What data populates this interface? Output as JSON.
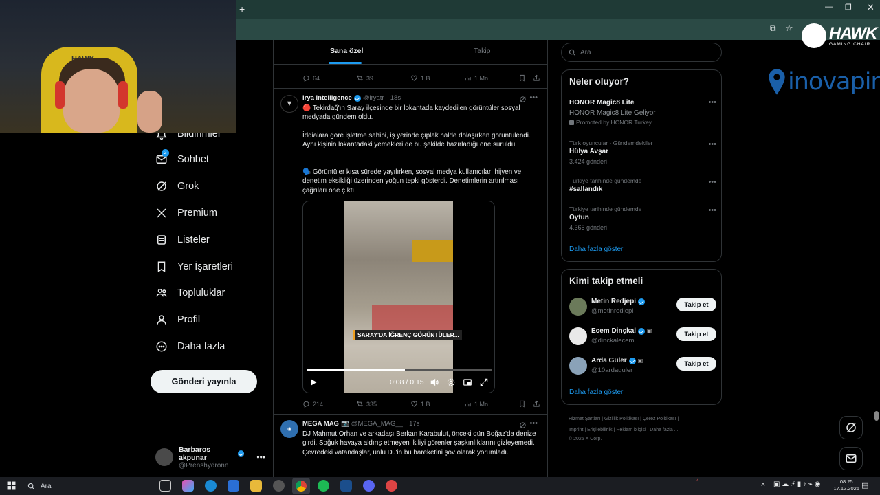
{
  "browser": {
    "new_tab_icon": "plus-icon",
    "window_controls": [
      "minimize-icon",
      "restore-icon",
      "close-icon"
    ]
  },
  "webcam": {
    "chair_brand": "HAWK"
  },
  "nav": {
    "items": [
      {
        "label": "Bildirimler",
        "icon": "bell-icon"
      },
      {
        "label": "Sohbet",
        "icon": "mail-icon",
        "badge": "2"
      },
      {
        "label": "Grok",
        "icon": "grok-icon"
      },
      {
        "label": "Premium",
        "icon": "x-logo-icon"
      },
      {
        "label": "Listeler",
        "icon": "list-icon"
      },
      {
        "label": "Yer İşaretleri",
        "icon": "bookmark-icon"
      },
      {
        "label": "Topluluklar",
        "icon": "people-icon"
      },
      {
        "label": "Profil",
        "icon": "person-icon"
      },
      {
        "label": "Daha fazla",
        "icon": "more-circle-icon"
      }
    ],
    "post_button": "Gönderi yayınla"
  },
  "account": {
    "name": "Barbaros akpunar",
    "handle": "@Prenshydronn"
  },
  "timeline": {
    "tabs": [
      {
        "label": "Sana özel",
        "active": true
      },
      {
        "label": "Takip",
        "active": false
      }
    ],
    "top_actions": {
      "replies": "64",
      "reposts": "39",
      "likes": "1 B",
      "views": "1 Mn"
    },
    "tweets": [
      {
        "name": "Irya Intelligence",
        "handle": "@iryatr",
        "time": "18s",
        "paragraphs": [
          "🔴 Tekirdağ'ın Saray ilçesinde bir lokantada kaydedilen görüntüler sosyal medyada gündem oldu.",
          "İddialara göre işletme sahibi, iş yerinde çıplak halde dolaşırken görüntülendi. Aynı kişinin lokantadaki yemekleri de bu şekilde hazırladığı öne sürüldü.",
          "🗣️ Görüntüler kısa sürede yayılırken, sosyal medya kullanıcıları hijyen ve denetim eksikliği üzerinden yoğun tepki gösterdi. Denetimlerin artırılması çağrıları öne çıktı."
        ],
        "video": {
          "caption": "SARAY'DA İĞRENÇ GÖRÜNTÜLER...",
          "time": "0:08 / 0:15",
          "progress": 0.53
        },
        "actions": {
          "replies": "214",
          "reposts": "335",
          "likes": "1 B",
          "views": "1 Mn"
        }
      },
      {
        "name": "MEGA MAG",
        "handle": "@MEGA_MAG__",
        "time": "17s",
        "paragraphs": [
          "DJ Mahmut Orhan ve arkadaşı Berkan Karabulut, önceki gün Boğaz'da denize girdi. Soğuk havaya aldırış etmeyen ikiliyi görenler şaşkınlıklarını gizleyemedi. Çevredeki vatandaşlar, ünlü DJ'in bu hareketini şov olarak yorumladı."
        ]
      }
    ]
  },
  "sidebar_right": {
    "search_placeholder": "Ara",
    "trends_title": "Neler oluyor?",
    "trends": [
      {
        "context": "",
        "name": "HONOR Magic8 Lite",
        "sub": "HONOR Magic8 Lite Geliyor",
        "promo": "Promoted by HONOR Turkey"
      },
      {
        "context": "Türk oyuncular · Gündemdekiler",
        "name": "Hülya Avşar",
        "sub": "3.424 gönderi"
      },
      {
        "context": "Türkiye tarihinde gündemde",
        "name": "#sallandık",
        "sub": ""
      },
      {
        "context": "Türkiye tarihinde gündemde",
        "name": "Oytun",
        "sub": "4.365 gönderi"
      }
    ],
    "trends_more": "Daha fazla göster",
    "follow_title": "Kimi takip etmeli",
    "follow": [
      {
        "name": "Metin Redjepi",
        "handle": "@metinredjepi",
        "button": "Takip et"
      },
      {
        "name": "Ecem Dinçkal",
        "handle": "@dinckalecem",
        "button": "Takip et"
      },
      {
        "name": "Arda Güler",
        "handle": "@10ardaguler",
        "button": "Takip et"
      }
    ],
    "follow_more": "Daha fazla göster",
    "footer_line1": "Hizmet Şartları  |  Gizlilik Politikası  |  Çerez Politikası  |",
    "footer_line2": "Imprint  |  Erişilebilirlik  |  Reklam bilgisi  |  Daha fazla ...",
    "footer_line3": "© 2025 X Corp."
  },
  "overlay": {
    "hawk_title": "HAWK",
    "hawk_sub": "GAMING CHAIR",
    "sponsor": "inovapin"
  },
  "taskbar": {
    "search_label": "Ara",
    "time": "08:25",
    "date": "17.12.2025",
    "notification_badge": "4"
  },
  "colors": {
    "accent": "#1d9bf0",
    "background": "#000000",
    "border": "#2f3336",
    "muted": "#71767b"
  }
}
